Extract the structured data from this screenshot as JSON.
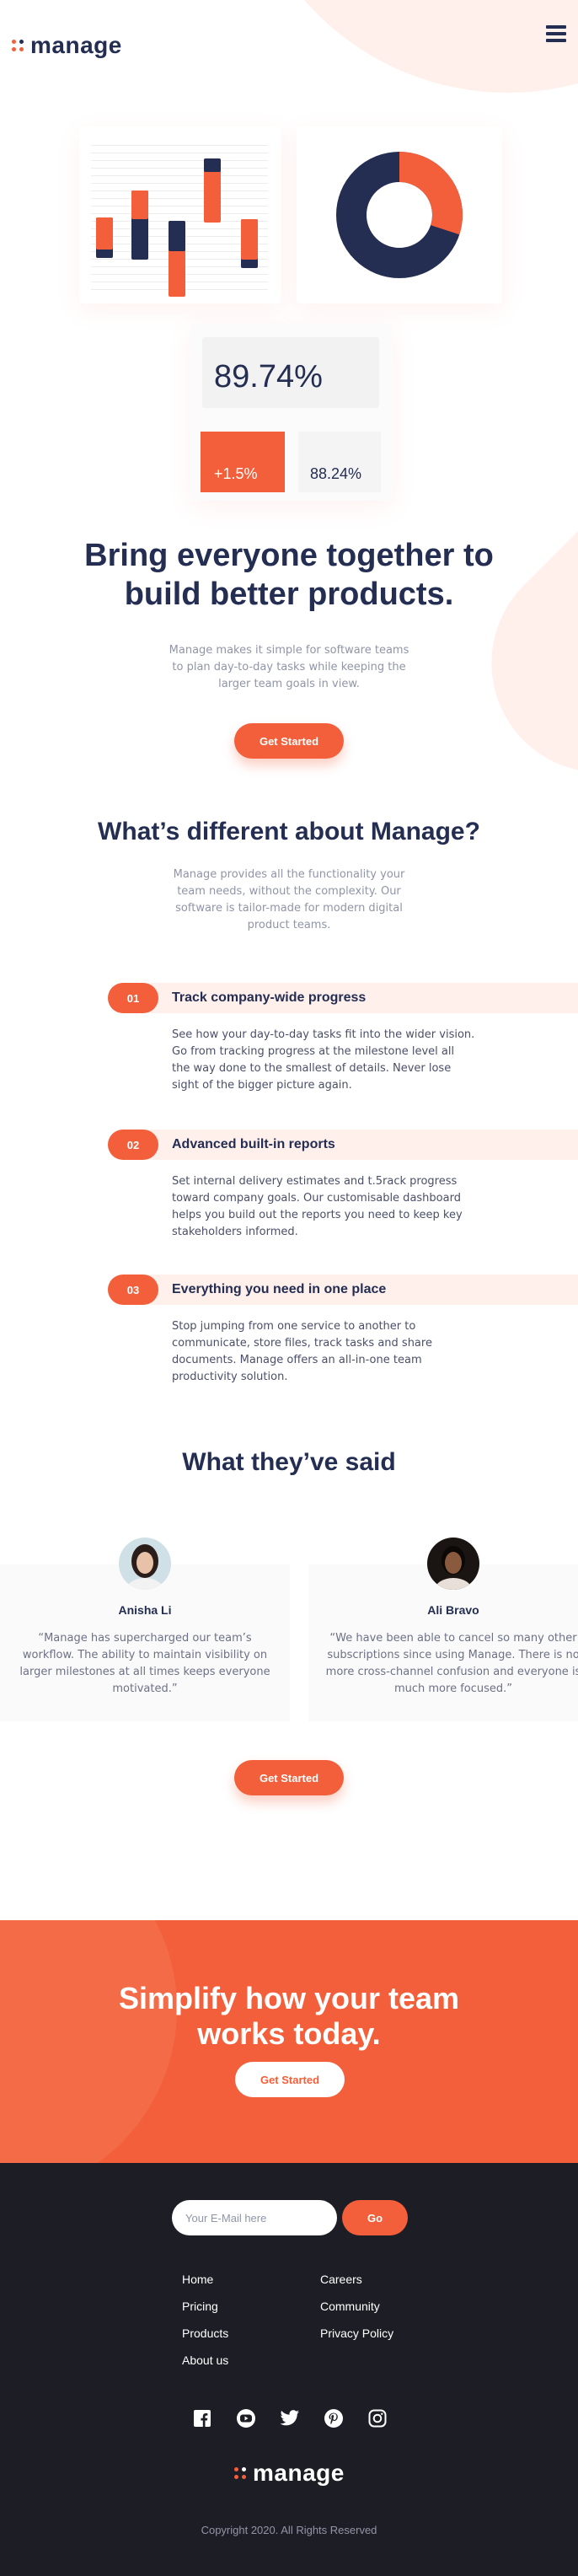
{
  "header": {
    "logo_text": "manage",
    "menu_icon": "hamburger-icon"
  },
  "dashboard": {
    "big_stat": "89.74%",
    "change_stat": "+1.5%",
    "small_stat": "88.24%",
    "donut_fraction_orange": 0.3
  },
  "hero": {
    "title_line1": "Bring everyone together to",
    "title_line2": "build better products.",
    "text": "Manage makes it simple for software teams to plan day-to-day tasks while keeping the larger team goals in view.",
    "cta": "Get Started"
  },
  "different": {
    "title": "What’s different about Manage?",
    "text": "Manage provides all the functionality your team needs, without the complexity. Our software is tailor-made for modern digital product teams.",
    "features": [
      {
        "num": "01",
        "title": "Track company-wide progress",
        "text": "See how your day-to-day tasks fit into the wider vision. Go from tracking progress at the milestone level all the way done to the smallest of details. Never lose sight of the bigger picture again."
      },
      {
        "num": "02",
        "title": "Advanced built-in reports",
        "text": "Set internal delivery estimates and t.5rack progress toward company goals. Our customisable dashboard helps you build out the reports you need to keep key stakeholders informed."
      },
      {
        "num": "03",
        "title": "Everything you need in one place",
        "text": "Stop jumping from one service to another to communicate, store files, track tasks and share documents. Manage offers an all-in-one team productivity solution."
      }
    ]
  },
  "testimonials": {
    "title": "What they’ve said",
    "items": [
      {
        "name": "Anisha Li",
        "quote": "“Manage has supercharged our team’s workflow. The ability to maintain visibility on larger milestones at all times keeps everyone motivated.”"
      },
      {
        "name": "Ali Bravo",
        "quote": "“We have been able to cancel so many other subscriptions since using Manage. There is no more cross-channel confusion and everyone is much more focused.”"
      }
    ],
    "cta": "Get Started"
  },
  "cta_band": {
    "title_line1": "Simplify how your team",
    "title_line2": "works today.",
    "cta": "Get Started"
  },
  "footer": {
    "email_placeholder": "Your E-Mail here",
    "go_label": "Go",
    "links_left": [
      "Home",
      "Pricing",
      "Products",
      "About us"
    ],
    "links_right": [
      "Careers",
      "Community",
      "Privacy Policy"
    ],
    "socials": [
      "facebook-icon",
      "youtube-icon",
      "twitter-icon",
      "pinterest-icon",
      "instagram-icon"
    ],
    "logo_text": "manage",
    "copyright": "Copyright 2020. All Rights Reserved"
  },
  "colors": {
    "accent": "#f25f3a",
    "navy": "#242d52",
    "footer_bg": "#1d1e25"
  }
}
